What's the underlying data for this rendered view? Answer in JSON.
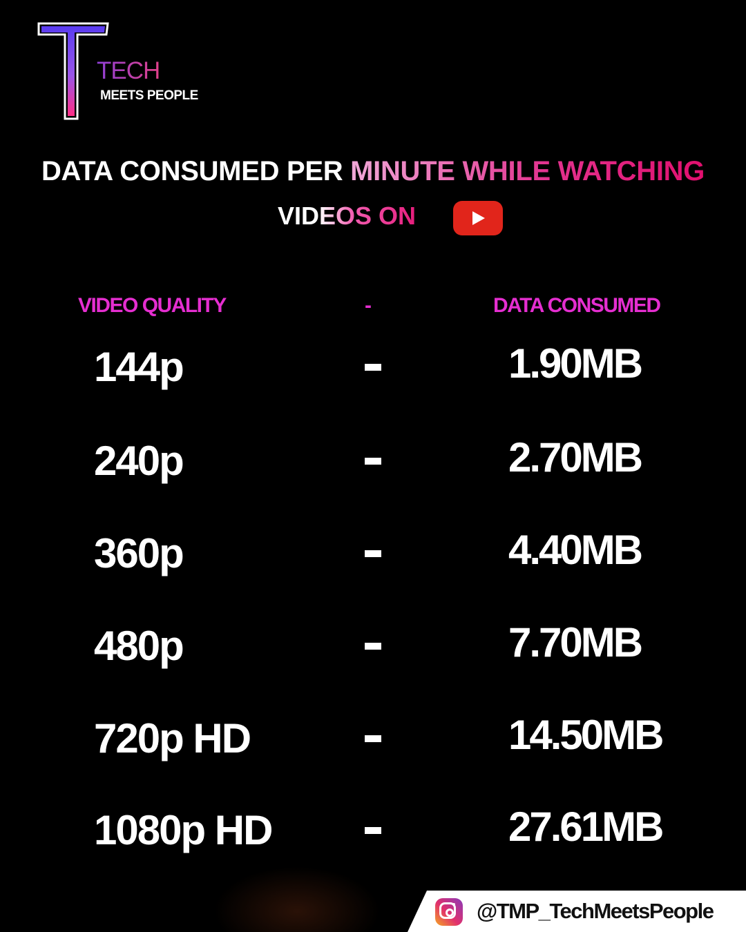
{
  "brand": {
    "line1": "TECH",
    "line2": "MEETS PEOPLE",
    "logo_icon": "t-logo-icon"
  },
  "title": {
    "line1_part1": "DATA CONSUMED PER ",
    "line1_part2": "MINUTE WHILE WATCHING",
    "line2_part1": "VID",
    "line2_part2": "EOS ON",
    "platform_icon": "youtube-icon"
  },
  "table": {
    "headers": {
      "quality": "VIDEO QUALITY",
      "separator": "-",
      "data": "DATA CONSUMED"
    },
    "rows": [
      {
        "quality": "144p",
        "data": "1.90MB"
      },
      {
        "quality": "240p",
        "data": "2.70MB"
      },
      {
        "quality": "360p",
        "data": "4.40MB"
      },
      {
        "quality": "480p",
        "data": "7.70MB"
      },
      {
        "quality": "720p HD",
        "data": "14.50MB"
      },
      {
        "quality": "1080p HD",
        "data": "27.61MB"
      }
    ]
  },
  "footer": {
    "handle": "@TMP_TechMeetsPeople",
    "icon": "instagram-icon"
  },
  "colors": {
    "accent_pink": "#e52ed0",
    "youtube_red": "#e1251b",
    "background": "#000000"
  }
}
